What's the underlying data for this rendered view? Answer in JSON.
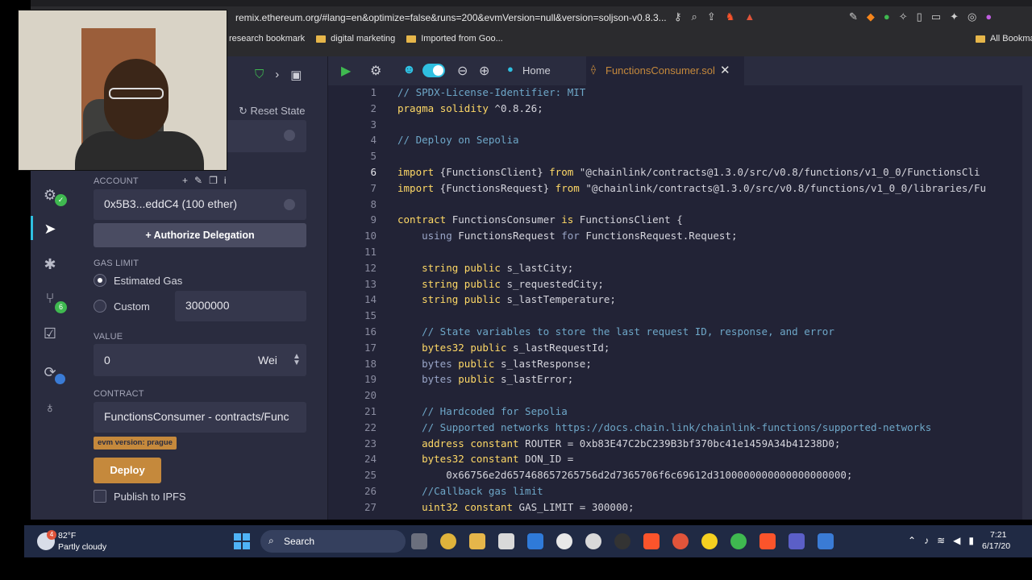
{
  "browser": {
    "url": "remix.ethereum.org/#lang=en&optimize=false&runs=200&evmVersion=null&version=soljson-v0.8.3...",
    "bookmarks": [
      "research bookmark",
      "digital marketing",
      "Imported from Goo..."
    ],
    "all_bookmarks": "All Bookmar"
  },
  "deploy_panel": {
    "reset_state": "Reset State",
    "account_label": "ACCOUNT",
    "account_value": "0x5B3...eddC4 (100 ether)",
    "authorize_label": "+ Authorize Delegation",
    "gas_limit_label": "GAS LIMIT",
    "estimated_gas_label": "Estimated Gas",
    "custom_label": "Custom",
    "custom_gas_value": "3000000",
    "value_label": "VALUE",
    "value_amount": "0",
    "value_unit": "Wei",
    "contract_label": "CONTRACT",
    "contract_value": "FunctionsConsumer - contracts/Func",
    "evm_badge": "evm version: prague",
    "deploy_label": "Deploy",
    "publish_ipfs_label": "Publish to IPFS"
  },
  "sidebar": {
    "git_badge": "6"
  },
  "editor": {
    "home_tab": "Home",
    "file_tab": "FunctionsConsumer.sol",
    "current_line": 6,
    "lines": [
      {
        "n": "1",
        "t": "// SPDX-License-Identifier: MIT"
      },
      {
        "n": "2",
        "t": "pragma solidity ^0.8.26;"
      },
      {
        "n": "3",
        "t": ""
      },
      {
        "n": "4",
        "t": "// Deploy on Sepolia"
      },
      {
        "n": "5",
        "t": ""
      },
      {
        "n": "6",
        "t": "import {FunctionsClient} from \"@chainlink/contracts@1.3.0/src/v0.8/functions/v1_0_0/FunctionsCli"
      },
      {
        "n": "7",
        "t": "import {FunctionsRequest} from \"@chainlink/contracts@1.3.0/src/v0.8/functions/v1_0_0/libraries/Fu"
      },
      {
        "n": "8",
        "t": ""
      },
      {
        "n": "9",
        "t": "contract FunctionsConsumer is FunctionsClient {"
      },
      {
        "n": "10",
        "t": "    using FunctionsRequest for FunctionsRequest.Request;"
      },
      {
        "n": "11",
        "t": ""
      },
      {
        "n": "12",
        "t": "    string public s_lastCity;"
      },
      {
        "n": "13",
        "t": "    string public s_requestedCity;"
      },
      {
        "n": "14",
        "t": "    string public s_lastTemperature;"
      },
      {
        "n": "15",
        "t": ""
      },
      {
        "n": "16",
        "t": "    // State variables to store the last request ID, response, and error"
      },
      {
        "n": "17",
        "t": "    bytes32 public s_lastRequestId;"
      },
      {
        "n": "18",
        "t": "    bytes public s_lastResponse;"
      },
      {
        "n": "19",
        "t": "    bytes public s_lastError;"
      },
      {
        "n": "20",
        "t": ""
      },
      {
        "n": "21",
        "t": "    // Hardcoded for Sepolia"
      },
      {
        "n": "22",
        "t": "    // Supported networks https://docs.chain.link/chainlink-functions/supported-networks"
      },
      {
        "n": "23",
        "t": "    address constant ROUTER = 0xb83E47C2bC239B3bf370bc41e1459A34b41238D0;"
      },
      {
        "n": "24",
        "t": "    bytes32 constant DON_ID ="
      },
      {
        "n": "25",
        "t": "        0x66756e2d657468657265756d2d7365706f6c69612d3100000000000000000000;"
      },
      {
        "n": "26",
        "t": "    //Callback gas limit"
      },
      {
        "n": "27",
        "t": "    uint32 constant GAS_LIMIT = 300000;"
      }
    ]
  },
  "taskbar": {
    "weather_temp": "82°F",
    "weather_desc": "Partly cloudy",
    "weather_badge": "4",
    "search_label": "Search",
    "clock_time": "7:21",
    "clock_date": "6/17/20"
  }
}
